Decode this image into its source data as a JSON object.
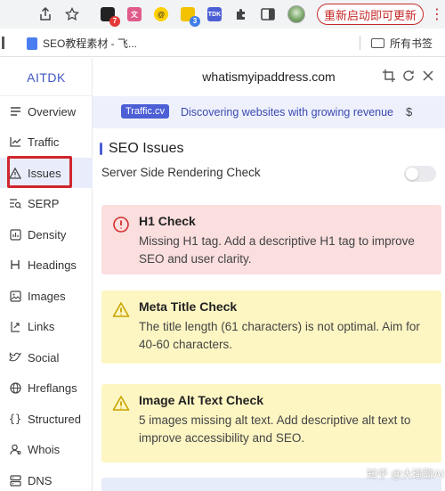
{
  "browser": {
    "restart_label": "重新启动即可更新",
    "extensions": [
      {
        "name": "extension-1",
        "badge": "7",
        "color": "#222222",
        "badge_color": "#e53935"
      },
      {
        "name": "extension-2",
        "color": "#e05a8a"
      },
      {
        "name": "extension-3",
        "color": "#ffd000"
      },
      {
        "name": "extension-4",
        "badge": "3",
        "color": "#f2c200",
        "badge_color": "#3f7ee8"
      },
      {
        "name": "extension-tdk",
        "label": "TDK",
        "color": "#4c5fd5"
      }
    ]
  },
  "bookmarks": {
    "item_label": "SEO教程素材 - 飞...",
    "all_label": "所有书签"
  },
  "sidebar": {
    "brand": "AITDK",
    "items": [
      {
        "label": "Overview",
        "icon": "list-icon"
      },
      {
        "label": "Traffic",
        "icon": "chart-icon"
      },
      {
        "label": "Issues",
        "icon": "warning-icon"
      },
      {
        "label": "SERP",
        "icon": "serp-icon"
      },
      {
        "label": "Density",
        "icon": "density-icon"
      },
      {
        "label": "Headings",
        "icon": "heading-icon"
      },
      {
        "label": "Images",
        "icon": "image-icon"
      },
      {
        "label": "Links",
        "icon": "link-icon"
      },
      {
        "label": "Social",
        "icon": "bird-icon"
      },
      {
        "label": "Hreflangs",
        "icon": "globe-icon"
      },
      {
        "label": "Structured",
        "icon": "braces-icon"
      },
      {
        "label": "Whois",
        "icon": "user-icon"
      },
      {
        "label": "DNS",
        "icon": "dns-icon"
      }
    ],
    "active_index": 2
  },
  "main": {
    "domain": "whatismyipaddress.com",
    "promo_tag": "Traffic.cv",
    "promo_text": "Discovering websites with growing revenue",
    "promo_icon": "$",
    "section_title": "SEO Issues",
    "ssr_label": "Server Side Rendering Check",
    "ssr_enabled": false,
    "cards": [
      {
        "type": "error",
        "title": "H1 Check",
        "text": "Missing H1 tag. Add a descriptive H1 tag to improve SEO and user clarity."
      },
      {
        "type": "warning",
        "title": "Meta Title Check",
        "text": "The title length (61 characters) is not optimal. Aim for 40-60 characters."
      },
      {
        "type": "warning",
        "title": "Image Alt Text Check",
        "text": "5 images missing alt text. Add descriptive alt text to improve accessibility and SEO."
      }
    ]
  },
  "watermark": "知乎 @大瑜聊AI",
  "colors": {
    "accent": "#4c5fd5",
    "error_bg": "#fbdede",
    "warning_bg": "#fdf6c3",
    "highlight": "#d0262d"
  }
}
